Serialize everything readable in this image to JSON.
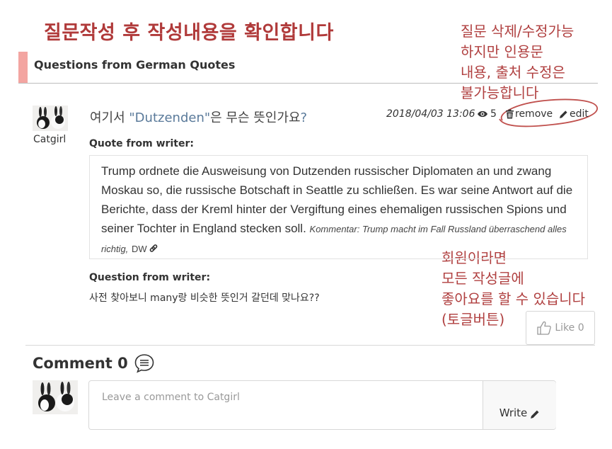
{
  "annotations": {
    "title": "질문작성 후 작성내용을 확인합니다",
    "edit_note": "질문 삭제/수정가능\n하지만 인용문\n내용, 출처 수정은\n불가능합니다",
    "like_note": "회원이라면\n모든 작성글에\n좋아요를 할 수 있습니다\n(토글버튼)"
  },
  "section": {
    "title": "Questions from German Quotes"
  },
  "post": {
    "author": "Catgirl",
    "title_prefix": "여기서 ",
    "title_quoted": "\"Dutzenden\"",
    "title_suffix": "은 무슨 뜻인가요",
    "title_mark": "?",
    "date": "2018/04/03 13:06",
    "views": "5",
    "remove_label": "remove",
    "edit_label": "edit",
    "quote_label": "Quote from writer:",
    "quote_text": "Trump ordnete die Ausweisung von Dutzenden russischer Diplomaten an und zwang Moskau so, die russische Botschaft in Seattle zu schließen. Es war seine Antwort auf die Berichte, dass der Kreml hinter der Vergiftung eines ehemaligen russischen Spions und seiner Tochter in England stecken soll.",
    "quote_source": "Kommentar: Trump macht im Fall Russland überraschend alles richtig,",
    "quote_publisher": "DW",
    "question_label": "Question from writer:",
    "question_text": "사전 찾아보니 many랑 비슷한 뜻인거 갈던데 맞나요??",
    "like_label": "Like 0"
  },
  "comments": {
    "title": "Comment 0",
    "placeholder": "Leave a comment to Catgirl",
    "write_label": "Write"
  },
  "colors": {
    "annotation": "#b04040",
    "section_bar": "#f3a5a1",
    "quoted_word": "#5a7a9a"
  },
  "icons": [
    "eye-icon",
    "trash-icon",
    "pencil-icon",
    "link-icon",
    "thumbs-up-icon",
    "speech-bubble-icon"
  ]
}
